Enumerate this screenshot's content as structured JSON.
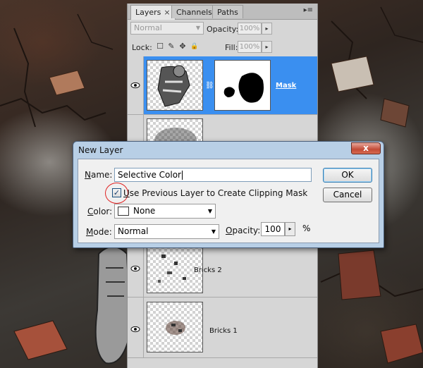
{
  "panel": {
    "tabs": [
      {
        "label": "Layers",
        "close": "×"
      },
      {
        "label": "Channels"
      },
      {
        "label": "Paths"
      }
    ],
    "menu_glyph": "▸≡",
    "blend_mode": "Normal",
    "opacity_label": "Opacity:",
    "opacity_value": "100%",
    "lock_label": "Lock:",
    "fill_label": "Fill:",
    "fill_value": "100%",
    "layers": [
      {
        "name": "Mask",
        "selected": true
      },
      {
        "name": ""
      },
      {
        "name": "Bricks 2"
      },
      {
        "name": "Bricks 1"
      }
    ]
  },
  "dialog": {
    "title": "New Layer",
    "close_glyph": "x",
    "name_label_key": "N",
    "name_label_rest": "ame:",
    "name_value": "Selective Color",
    "clip_label_key": "U",
    "clip_label_rest": "se Previous Layer to Create Clipping Mask",
    "clip_checked": "✓",
    "color_label_key": "C",
    "color_label_rest": "olor:",
    "color_value": "None",
    "mode_label_key": "M",
    "mode_label_rest": "ode:",
    "mode_value": "Normal",
    "opacity_label_key": "O",
    "opacity_label_rest": "pacity:",
    "opacity_value": "100",
    "opacity_unit": "%",
    "ok_label": "OK",
    "cancel_label": "Cancel"
  },
  "icons": {
    "dropdown": "▼",
    "spin": "▸",
    "lock_transparency": "☐",
    "lock_paint": "✎",
    "lock_move": "✥",
    "lock_all": "🔒",
    "chain": "⛓"
  },
  "colors": {
    "selection": "#3a8ff0",
    "dialog_frame": "#b8cfe6",
    "annotation": "#e02424"
  }
}
